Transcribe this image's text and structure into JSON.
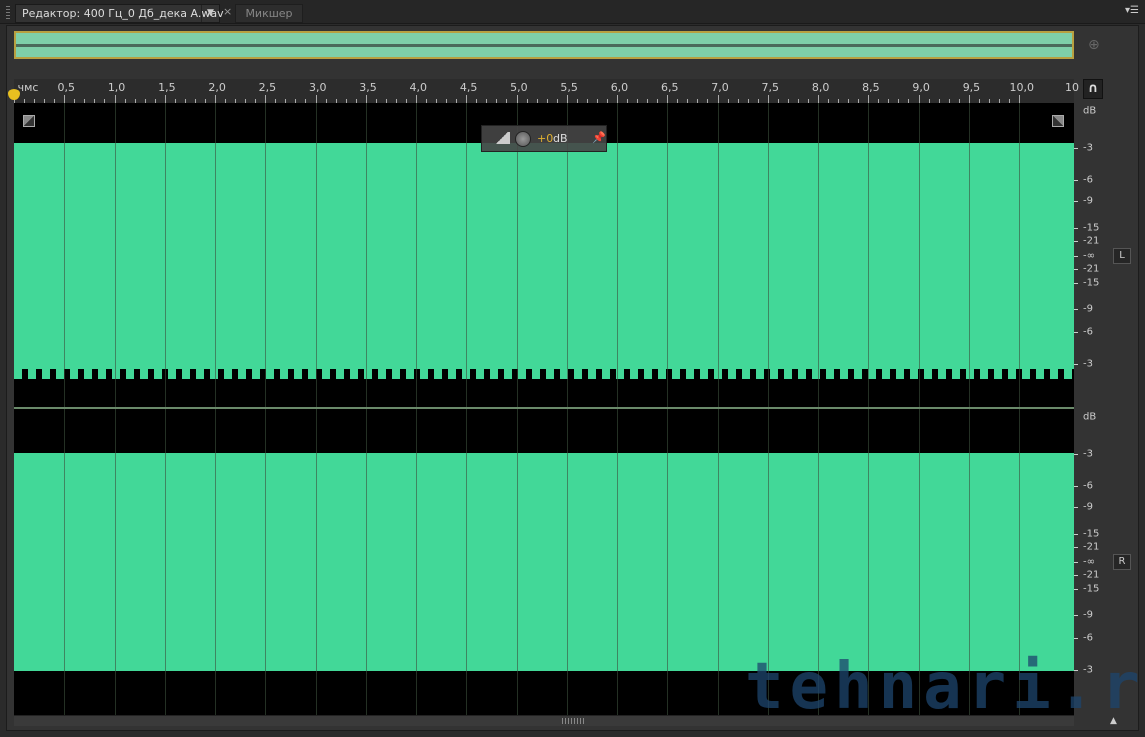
{
  "tabs": {
    "editor_label": "Редактор: 400 Гц_0 Дб_дека A.wav",
    "mixer_label": "Микшер",
    "dropdown_icon": "triangle-down-icon",
    "close_icon": "close-icon",
    "panel_menu_icon": "menu-icon"
  },
  "ruler": {
    "unit": "чмс",
    "labels": [
      "0,5",
      "1,0",
      "1,5",
      "2,0",
      "2,5",
      "3,0",
      "3,5",
      "4,0",
      "4,5",
      "5,0",
      "5,5",
      "6,0",
      "6,5",
      "7,0",
      "7,5",
      "8,0",
      "8,5",
      "9,0",
      "9,5",
      "10,0",
      "10"
    ]
  },
  "hud": {
    "gain_value": "+0",
    "gain_unit": "dB"
  },
  "db_scale": [
    "dB",
    "-3",
    "-6",
    "-9",
    "-15",
    "-21",
    "-∞",
    "-21",
    "-15",
    "-9",
    "-6",
    "-3"
  ],
  "channels": [
    {
      "label": "L"
    },
    {
      "label": "R"
    }
  ],
  "colors": {
    "waveform": "#42d898",
    "background": "#000000",
    "playhead": "#e8c020"
  },
  "watermark": "tehnari.ru"
}
